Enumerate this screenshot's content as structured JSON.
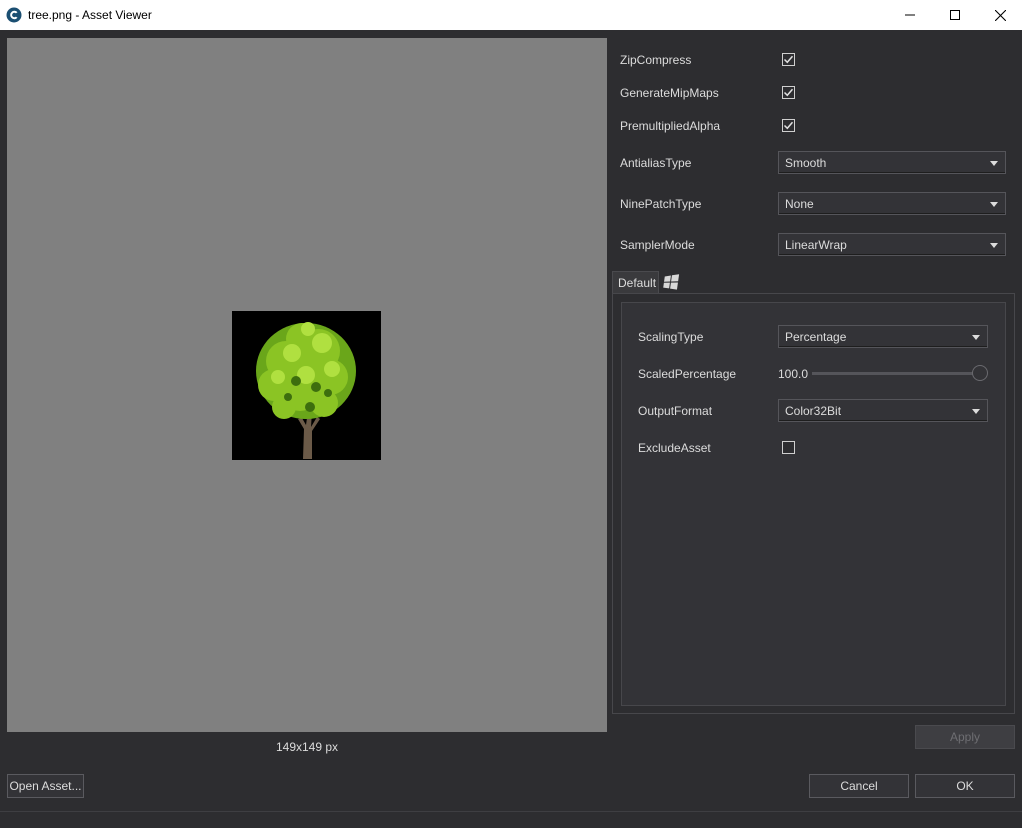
{
  "window": {
    "title": "tree.png - Asset Viewer",
    "icon": "app-logo-icon"
  },
  "preview": {
    "dimensions_label": "149x149 px",
    "image_subject": "tree"
  },
  "properties": {
    "zip_compress": {
      "label": "ZipCompress",
      "checked": true
    },
    "generate_mipmaps": {
      "label": "GenerateMipMaps",
      "checked": true
    },
    "premultiplied_alpha": {
      "label": "PremultipliedAlpha",
      "checked": true
    },
    "antialias_type": {
      "label": "AntialiasType",
      "value": "Smooth"
    },
    "ninepatch_type": {
      "label": "NinePatchType",
      "value": "None"
    },
    "sampler_mode": {
      "label": "SamplerMode",
      "value": "LinearWrap"
    }
  },
  "tabs": [
    {
      "label": "Default",
      "active": true
    },
    {
      "label": "",
      "icon": "windows-logo-icon",
      "active": false
    }
  ],
  "platform_settings": {
    "scaling_type": {
      "label": "ScalingType",
      "value": "Percentage"
    },
    "scaled_percentage": {
      "label": "ScaledPercentage",
      "value": "100.0",
      "fraction": 1.0
    },
    "output_format": {
      "label": "OutputFormat",
      "value": "Color32Bit"
    },
    "exclude_asset": {
      "label": "ExcludeAsset",
      "checked": false
    }
  },
  "buttons": {
    "apply": "Apply",
    "open_asset": "Open Asset...",
    "cancel": "Cancel",
    "ok": "OK"
  },
  "colors": {
    "background": "#2d2d30",
    "preview_bg": "#808080",
    "text": "#dcdcdc",
    "disabled_text": "#6e6e72"
  }
}
